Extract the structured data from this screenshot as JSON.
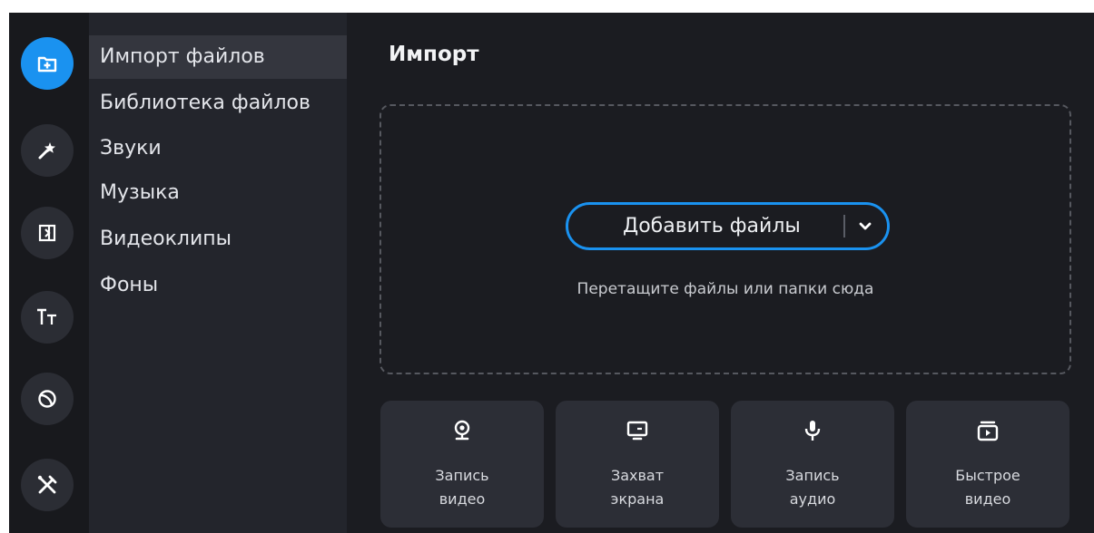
{
  "rail": {
    "items": [
      {
        "icon": "import-icon",
        "active": true
      },
      {
        "icon": "magic-wand-icon",
        "active": false
      },
      {
        "icon": "transitions-icon",
        "active": false
      },
      {
        "icon": "titles-icon",
        "active": false
      },
      {
        "icon": "stickers-icon",
        "active": false
      },
      {
        "icon": "tools-icon",
        "active": false
      }
    ]
  },
  "sidebar": {
    "items": [
      {
        "label": "Импорт файлов",
        "active": true
      },
      {
        "label": "Библиотека файлов"
      },
      {
        "label": "Звуки"
      },
      {
        "label": "Музыка"
      },
      {
        "label": "Видеоклипы"
      },
      {
        "label": "Фоны"
      }
    ]
  },
  "main": {
    "title": "Импорт",
    "add_button": {
      "label": "Добавить файлы"
    },
    "drop_hint": "Перетащите файлы или папки сюда",
    "tiles": [
      {
        "line1": "Запись",
        "line2": "видео",
        "icon": "webcam-icon"
      },
      {
        "line1": "Захват",
        "line2": "экрана",
        "icon": "screen-capture-icon"
      },
      {
        "line1": "Запись",
        "line2": "аудио",
        "icon": "microphone-icon"
      },
      {
        "line1": "Быстрое",
        "line2": "видео",
        "icon": "quick-video-icon"
      }
    ]
  },
  "colors": {
    "accent": "#1a92f0",
    "rail_bg": "#18191d",
    "sidebar_bg": "#23252c",
    "main_bg": "#1b1c21",
    "tile_bg": "#2c2e36"
  }
}
